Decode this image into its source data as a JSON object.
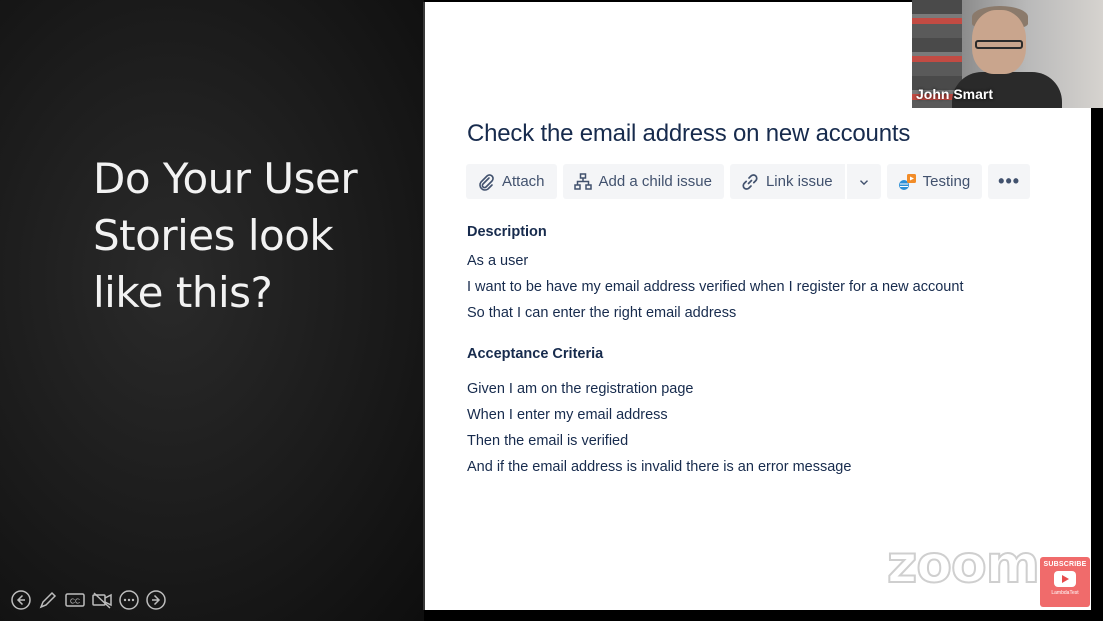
{
  "slide": {
    "title_lines": [
      "Do Your User",
      "Stories look",
      "like this?"
    ]
  },
  "slide_controls": [
    "back-icon",
    "pen-icon",
    "captions-icon",
    "video-off-icon",
    "more-icon",
    "forward-icon"
  ],
  "jira": {
    "issue_title": "Check the email address on new accounts",
    "toolbar": {
      "attach_label": "Attach",
      "child_issue_label": "Add a child issue",
      "link_issue_label": "Link issue",
      "testing_label": "Testing",
      "more_label": "•••"
    },
    "description": {
      "heading": "Description",
      "lines": [
        "As a user",
        "I want to be have my email address verified when I register for a new account",
        "So that I can enter the right email address"
      ]
    },
    "acceptance": {
      "heading": "Acceptance Criteria",
      "lines": [
        "Given I am on the registration page",
        "When I enter my email address",
        "Then the email is verified",
        "And if the email address is invalid there is an error message"
      ]
    }
  },
  "overlay": {
    "watermark": "zoom",
    "subscribe_label": "SUBSCRIBE",
    "subscribe_brand": "LambdaTest"
  },
  "webcam": {
    "participant_name": "John Smart"
  },
  "colors": {
    "jira_text": "#172b4d",
    "toolbar_bg": "#f4f5f7",
    "subscribe_bg": "#f06b6b"
  }
}
